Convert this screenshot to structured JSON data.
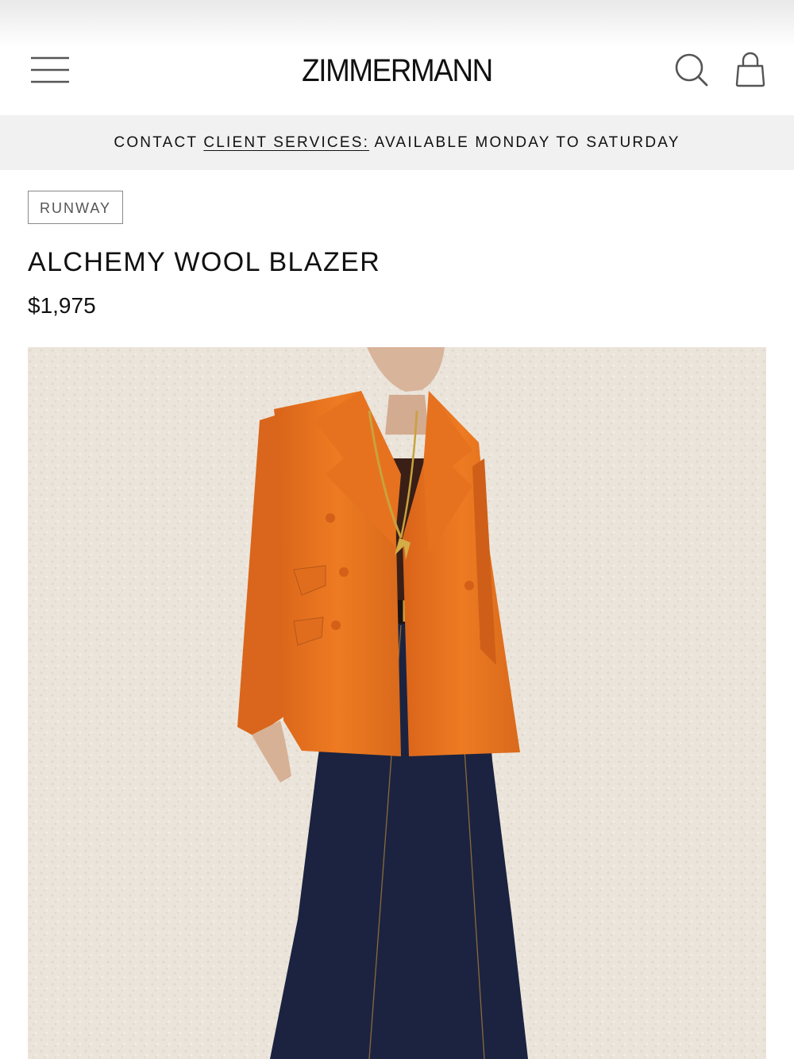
{
  "header": {
    "brand": "ZIMMERMANN",
    "icons": {
      "menu": "hamburger-menu-icon",
      "search": "search-icon",
      "bag": "shopping-bag-icon"
    }
  },
  "banner": {
    "prefix": "CONTACT ",
    "link_text": "CLIENT SERVICES:",
    "suffix": " AVAILABLE MONDAY TO SATURDAY"
  },
  "product": {
    "badge": "RUNWAY",
    "title": "ALCHEMY WOOL BLAZER",
    "price": "$1,975"
  },
  "colors": {
    "text": "#111111",
    "banner_bg": "#f1f1f1",
    "blazer": "#e8741e",
    "jeans": "#1b2340",
    "wall": "#ece5dc"
  }
}
